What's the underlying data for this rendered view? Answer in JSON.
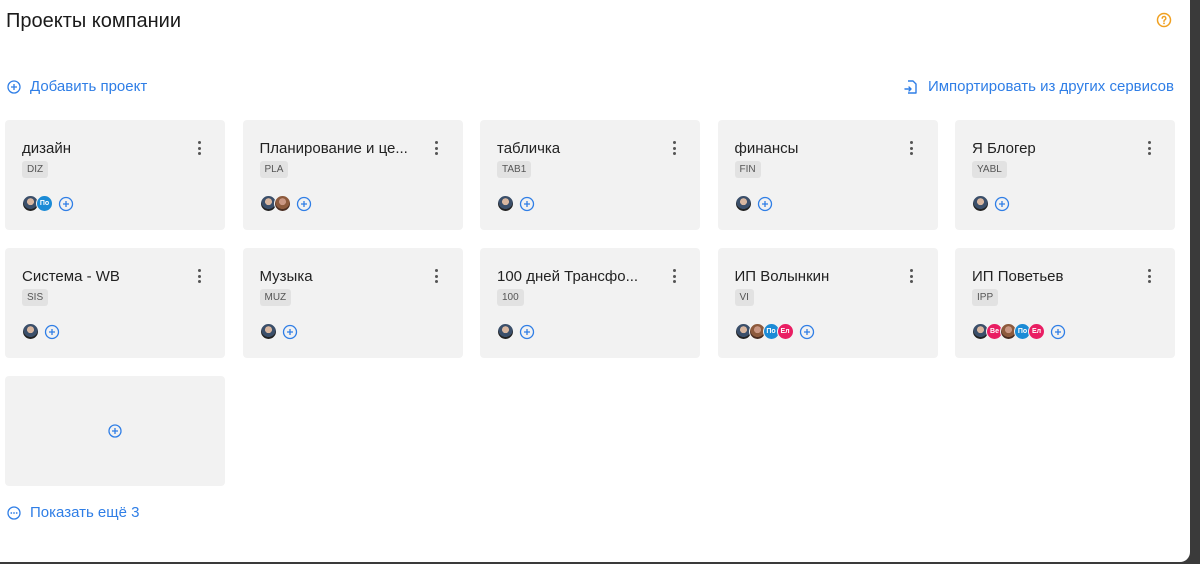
{
  "page": {
    "title": "Проекты компании"
  },
  "toolbar": {
    "add_project_label": "Добавить проект",
    "import_label": "Импортировать из других сервисов"
  },
  "colors": {
    "accent": "#2f7ee6",
    "help": "#f0a020",
    "card_bg": "#f2f2f2",
    "code_bg": "#e2e2e2"
  },
  "projects": [
    {
      "title": "дизайн",
      "code": "DIZ",
      "members": [
        {
          "kind": "photo",
          "initials": ""
        },
        {
          "kind": "initials",
          "initials": "По",
          "color": "#1b8bd6"
        }
      ]
    },
    {
      "title": "Планирование и це...",
      "code": "PLA",
      "members": [
        {
          "kind": "photo",
          "initials": ""
        },
        {
          "kind": "photo2",
          "initials": ""
        }
      ]
    },
    {
      "title": "табличка",
      "code": "TAB1",
      "members": [
        {
          "kind": "photo",
          "initials": ""
        }
      ]
    },
    {
      "title": "финансы",
      "code": "FIN",
      "members": [
        {
          "kind": "photo",
          "initials": ""
        }
      ]
    },
    {
      "title": "Я Блогер",
      "code": "YABL",
      "members": [
        {
          "kind": "photo",
          "initials": ""
        }
      ]
    },
    {
      "title": "Система - WB",
      "code": "SIS",
      "members": [
        {
          "kind": "photo",
          "initials": ""
        }
      ]
    },
    {
      "title": "Музыка",
      "code": "MUZ",
      "members": [
        {
          "kind": "photo",
          "initials": ""
        }
      ]
    },
    {
      "title": "100 дней Трансфо...",
      "code": "100",
      "members": [
        {
          "kind": "photo",
          "initials": ""
        }
      ]
    },
    {
      "title": "ИП Волынкин",
      "code": "VI",
      "members": [
        {
          "kind": "photo",
          "initials": ""
        },
        {
          "kind": "photo2",
          "initials": ""
        },
        {
          "kind": "initials",
          "initials": "По",
          "color": "#1b8bd6"
        },
        {
          "kind": "initials",
          "initials": "Ел",
          "color": "#e91e63"
        }
      ]
    },
    {
      "title": "ИП Поветьев",
      "code": "IPP",
      "members": [
        {
          "kind": "photo",
          "initials": ""
        },
        {
          "kind": "initials",
          "initials": "Ве",
          "color": "#e91e63"
        },
        {
          "kind": "photo2",
          "initials": ""
        },
        {
          "kind": "initials",
          "initials": "По",
          "color": "#1b8bd6"
        },
        {
          "kind": "initials",
          "initials": "Ел",
          "color": "#e91e63"
        }
      ]
    }
  ],
  "footer": {
    "show_more_label": "Показать ещё 3"
  },
  "icons": {
    "help": "question-circle-icon",
    "add": "plus-circle-icon",
    "import": "import-file-icon",
    "menu": "kebab-menu-icon",
    "more": "ellipsis-circle-icon"
  }
}
